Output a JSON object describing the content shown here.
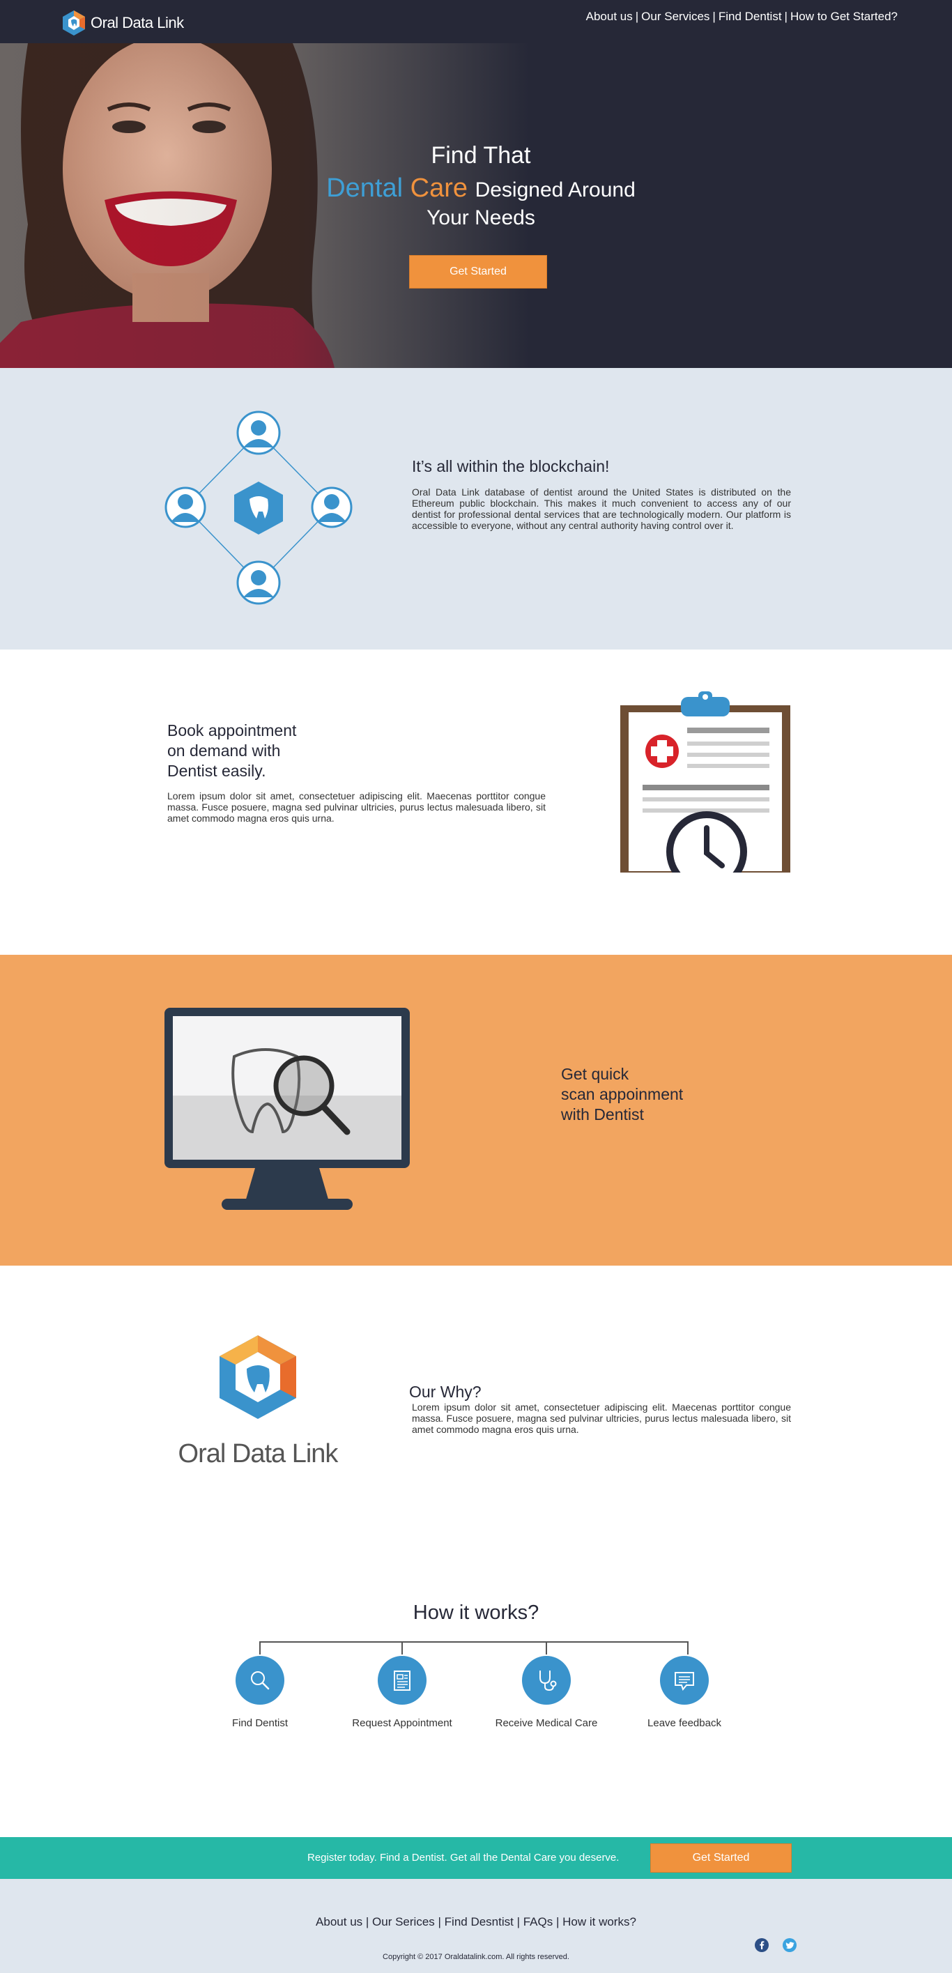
{
  "header": {
    "brand": "Oral Data Link",
    "nav": [
      "About us",
      "Our Services",
      "Find Dentist",
      "How to Get Started?"
    ]
  },
  "hero": {
    "line1": "Find That",
    "line2_blue": "Dental",
    "line2_orange": "Care",
    "line2_rest": "Designed Around",
    "line3": "Your Needs",
    "cta": "Get Started"
  },
  "blockchain": {
    "title": "It’s all within the blockchain!",
    "body": "Oral Data Link database of dentist around the United States is distributed on the Ethereum public blockchain. This makes it much convenient to access any of our dentist for professional dental services that are technologically modern. Our platform is accessible to everyone, without any central authority having control over it."
  },
  "book": {
    "title_lines": [
      "Book appointment",
      "on demand with",
      "Dentist easily."
    ],
    "body": "Lorem ipsum dolor sit amet, consectetuer adipiscing elit. Maecenas porttitor congue massa. Fusce posuere, magna sed pulvinar ultricies, purus lectus malesuada libero, sit amet commodo magna eros quis urna."
  },
  "scan": {
    "title_lines": [
      "Get quick",
      "scan appoinment",
      "with Dentist"
    ]
  },
  "why": {
    "brand": "Oral Data Link",
    "title": "Our Why?",
    "body": "Lorem ipsum dolor sit amet, consectetuer adipiscing elit. Maecenas porttitor congue massa. Fusce posuere, magna sed pulvinar ultricies, purus lectus malesuada libero, sit amet commodo magna eros quis urna."
  },
  "how": {
    "title": "How it works?",
    "steps": [
      {
        "label": "Find Dentist",
        "icon": "search-icon"
      },
      {
        "label": "Request Appointment",
        "icon": "document-icon"
      },
      {
        "label": "Receive Medical Care",
        "icon": "stethoscope-icon"
      },
      {
        "label": "Leave feedback",
        "icon": "chat-icon"
      }
    ]
  },
  "cta_bar": {
    "text": "Register today. Find a Dentist. Get all the Dental Care you deserve.",
    "button": "Get Started"
  },
  "footer": {
    "nav": [
      "About us",
      "Our Serices",
      "Find Desntist",
      "FAQs",
      "How it works?"
    ],
    "copyright": "Copyright © 2017 Oraldatalink.com. All rights reserved.",
    "social": [
      "facebook-icon",
      "twitter-icon"
    ]
  },
  "colors": {
    "dark": "#262837",
    "blue": "#3a93cc",
    "orange": "#f0923d",
    "teal": "#26b8a6",
    "light": "#dfe6ee",
    "peach": "#f2a560"
  }
}
